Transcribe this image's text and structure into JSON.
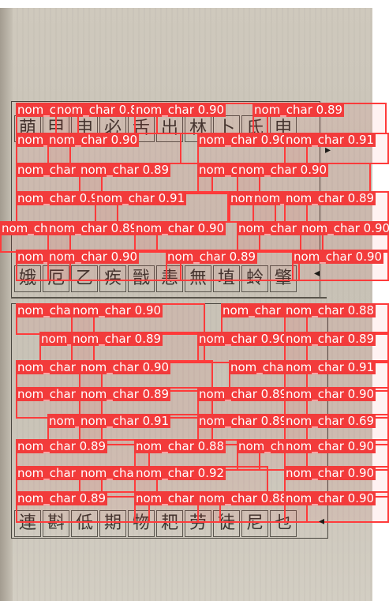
{
  "document": {
    "glyph_rows": [
      "萌甲申必舌出林卜氏申",
      "娥厄乙疾戩恚無埴蛉𦘦",
      "連斟低期物耙劳徒尼乜"
    ]
  },
  "detections": {
    "labels": [
      "nom_char",
      "nom_char 0.89",
      "nom_char 0.90",
      "nom_char 0.89",
      "nom_char 0.90",
      "nom_char 0.90",
      "nom_char 0.90",
      "nom_char 0.91",
      "nom_char 0.89",
      "nom_char 0.89",
      "nom_char 0.89",
      "nom_char 0.90",
      "nom_char 0.90",
      "nom_char 0.91",
      "nom_char 0.89",
      "nom_char 0.69",
      "nom_char 0.89",
      "nom_char 0.88",
      "nom_char 0.89",
      "nom_char 0.90",
      "nom_char 0.90",
      "nom_char 0.90",
      "nom_char 0.92",
      "nom_char 0.90",
      "nom_char 0.89",
      "nom_char 0.90",
      "nom_char 0.88",
      "nom_char 0.90",
      "nom_char 0.90",
      "nom_char 0.88"
    ]
  }
}
